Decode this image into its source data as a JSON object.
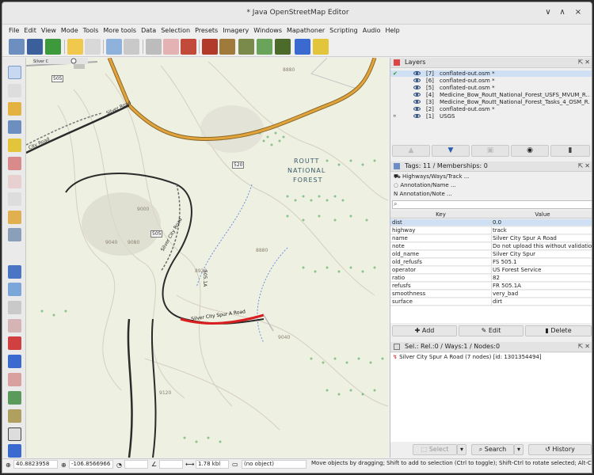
{
  "window": {
    "title": "* Java OpenStreetMap Editor",
    "controls": [
      "∨",
      "∧",
      "×"
    ]
  },
  "menu": [
    "File",
    "Edit",
    "View",
    "Mode",
    "Tools",
    "More tools",
    "Data",
    "Selection",
    "Presets",
    "Imagery",
    "Windows",
    "Mapathoner",
    "Scripting",
    "Audio",
    "Help"
  ],
  "map": {
    "labels": {
      "roads_top_left": "Silver C",
      "silver_road_1": "Silver Road",
      "city_road": "City Road",
      "shield_505_top": "505",
      "shield_520": "520",
      "shield_505_mid": "505",
      "contour_9000": "9000",
      "contour_9040": "9040",
      "contour_9080": "9080",
      "contour_8880": "8880",
      "contour_8920": "8920",
      "contour_9040b": "9040",
      "contour_9120": "9120",
      "contour_8880_top": "8880",
      "forest_1": "ROUTT",
      "forest_2": "NATIONAL",
      "forest_3": "FOREST",
      "vertical_road": "505.1A",
      "spur_road_label": "Silver City Spur A Road",
      "silver_city_road": "Silver City Road"
    }
  },
  "layers": {
    "header": "Layers",
    "items": [
      {
        "num": "[7]",
        "name": "conflated-out.osm *",
        "selected": true
      },
      {
        "num": "[6]",
        "name": "conflated-out.osm *",
        "selected": false
      },
      {
        "num": "[5]",
        "name": "conflated-out.osm *",
        "selected": false
      },
      {
        "num": "[4]",
        "name": "Medicine_Bow_Routt_National_Forest_USFS_MVUM_R...",
        "selected": false
      },
      {
        "num": "[3]",
        "name": "Medicine_Bow_Routt_National_Forest_Tasks_4_OSM_R...",
        "selected": false
      },
      {
        "num": "[2]",
        "name": "conflated-out.osm *",
        "selected": false
      },
      {
        "num": "[1]",
        "name": "USGS",
        "selected": false
      }
    ]
  },
  "tags": {
    "header": "Tags: 11 / Memberships: 0",
    "presets": [
      "Highways/Ways/Track ...",
      "Annotation/Name ...",
      "Annotation/Note ..."
    ],
    "key_col": "Key",
    "value_col": "Value",
    "rows": [
      {
        "k": "dist",
        "v": "0.0"
      },
      {
        "k": "highway",
        "v": "track"
      },
      {
        "k": "name",
        "v": "Silver City Spur A Road"
      },
      {
        "k": "note",
        "v": "Do not upload this without validation!"
      },
      {
        "k": "old_name",
        "v": "Silver City Spur"
      },
      {
        "k": "old_refusfs",
        "v": "FS 505.1"
      },
      {
        "k": "operator",
        "v": "US Forest Service"
      },
      {
        "k": "ratio",
        "v": "82"
      },
      {
        "k": "refusfs",
        "v": "FR 505.1A"
      },
      {
        "k": "smoothness",
        "v": "very_bad"
      },
      {
        "k": "surface",
        "v": "dirt"
      }
    ],
    "add": "Add",
    "edit": "Edit",
    "delete": "Delete"
  },
  "selection": {
    "header": "Sel.: Rel.:0 / Ways:1 / Nodes:0",
    "item": "Silver City Spur A Road (7 nodes) [id: 1301354494]",
    "select": "Select",
    "search": "Search",
    "history": "History"
  },
  "status": {
    "lat": "40.8823958",
    "lon": "-106.8566966",
    "dist": "1.78 kbl",
    "object": "(no object)",
    "help": "Move objects by dragging; Shift to add to selection (Ctrl to toggle); Shift-Ctrl to rotate selected; Alt-Ctrl to sca"
  },
  "colors": {
    "accent": "#2a5db0",
    "selected": "#cfe0f5",
    "road_orange": "#e3a33b",
    "spur_red": "#d81e1e"
  }
}
